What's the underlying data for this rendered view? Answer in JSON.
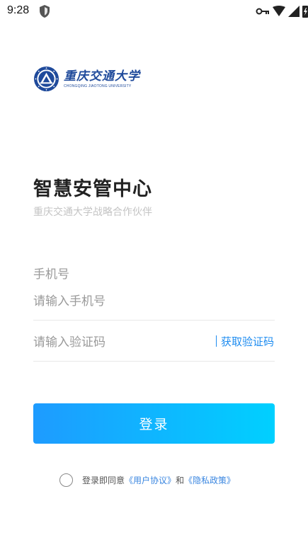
{
  "status_bar": {
    "time": "9:28",
    "icons": [
      "shield-icon",
      "vpn-key-icon",
      "wifi-icon",
      "signal-icon",
      "battery-icon"
    ]
  },
  "logo": {
    "name_cn": "重庆交通大学",
    "name_en": "CHONGQING JIAOTONG UNIVERSITY",
    "color": "#1f4a9b"
  },
  "page": {
    "title": "智慧安管中心",
    "subtitle": "重庆交通大学战略合作伙伴"
  },
  "form": {
    "phone_label": "手机号",
    "phone_placeholder": "请输入手机号",
    "phone_value": "",
    "code_placeholder": "请输入验证码",
    "code_value": "",
    "get_code_label": "获取验证码"
  },
  "login_button": {
    "label": "登录",
    "gradient": [
      "#1e9bff",
      "#00d0ff"
    ]
  },
  "agreement": {
    "checked": false,
    "prefix": "登录即同意",
    "user_agreement": "《用户协议》",
    "conjunction": "和",
    "privacy_policy": "《隐私政策》"
  },
  "colors": {
    "accent": "#1e8cf0",
    "link": "#3a86e0",
    "placeholder": "#9a9a9a",
    "subtitle": "#c4c4c4"
  }
}
